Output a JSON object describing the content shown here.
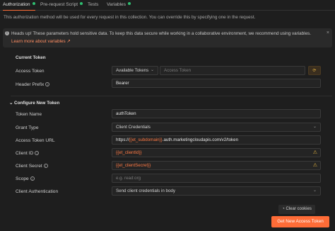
{
  "tabs": {
    "authorization": "Authorization",
    "prerequest": "Pre-request Script",
    "tests": "Tests",
    "variables": "Variables"
  },
  "description": "This authorization method will be used for every request in this collection. You can override this by specifying one in the request.",
  "banner": {
    "message": "Heads up! These parameters hold sensitive data. To keep this data secure while working in a collaborative environment, we recommend using variables.",
    "link": "Learn more about variables ↗",
    "close": "×"
  },
  "current_token": {
    "title": "Current Token",
    "access_token_label": "Access Token",
    "available_tokens": "Available Tokens",
    "access_token_placeholder": "Access Token",
    "header_prefix_label": "Header Prefix",
    "header_prefix_value": "Bearer"
  },
  "new_token": {
    "title": "Configure New Token",
    "token_name_label": "Token Name",
    "token_name_value": "authToken",
    "grant_type_label": "Grant Type",
    "grant_type_value": "Client Credentials",
    "access_token_url_label": "Access Token URL",
    "url_prefix": "https://",
    "url_var": "{{et_subdomain}}",
    "url_suffix": ".auth.marketingcloudapis.com/v2/token",
    "client_id_label": "Client ID",
    "client_id_value": "{{et_clientId}}",
    "client_secret_label": "Client Secret",
    "client_secret_value": "{{et_clientSecret}}",
    "scope_label": "Scope",
    "scope_placeholder": "e.g. read:org",
    "client_auth_label": "Client Authentication",
    "client_auth_value": "Send client credentials in body"
  },
  "buttons": {
    "clear_cookies": "Clear cookies",
    "get_token": "Get New Access Token"
  },
  "colors": {
    "accent": "#ff6c37",
    "status_dot": "#2fbf71",
    "warning": "#e3b341"
  }
}
